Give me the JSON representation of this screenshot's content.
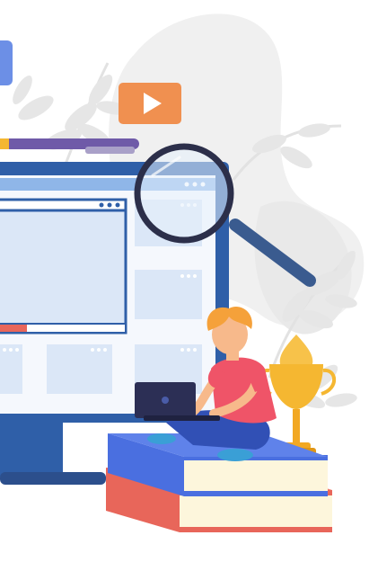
{
  "illustration": {
    "subject": "person-with-laptop-on-books",
    "colors": {
      "monitor_frame": "#2f5fa8",
      "monitor_screen": "#d9e6f7",
      "monitor_header": "#8fb6e8",
      "book_blue": "#4a6fe0",
      "book_red": "#e8665a",
      "book_pages": "#fdf6dc",
      "trophy": "#f5b731",
      "play_button": "#f09050",
      "shirt": "#ef5468",
      "hair": "#f5a13a",
      "skin": "#f7b98b",
      "pants": "#3150b5",
      "laptop": "#2c2f55",
      "magnifier": "#2c2f4a",
      "magnifier_handle": "#3a5b8f",
      "leaves": "#ececec",
      "blob": "#f0f0f0"
    }
  }
}
